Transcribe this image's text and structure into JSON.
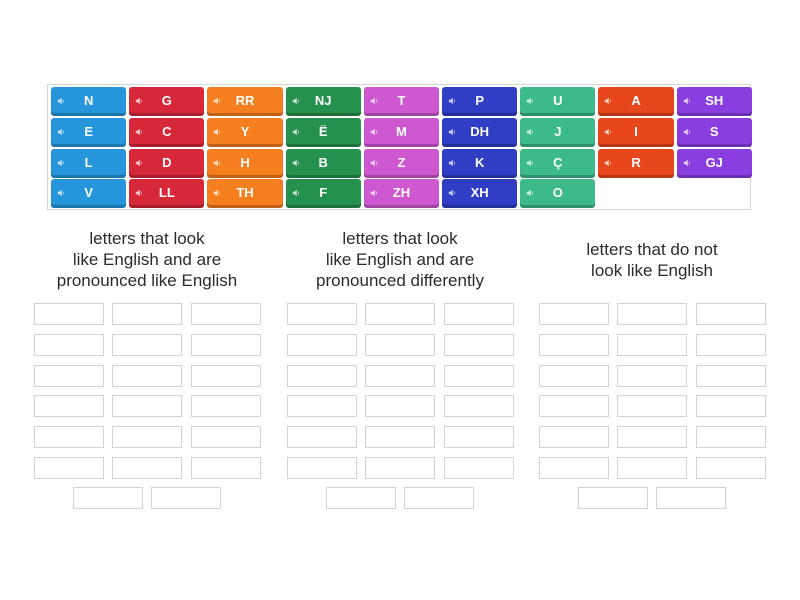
{
  "tiles": [
    {
      "label": "N",
      "color": "#2596dc"
    },
    {
      "label": "G",
      "color": "#d7283a"
    },
    {
      "label": "RR",
      "color": "#f57e1e"
    },
    {
      "label": "NJ",
      "color": "#24914f"
    },
    {
      "label": "T",
      "color": "#cd58d0"
    },
    {
      "label": "P",
      "color": "#2f3ec4"
    },
    {
      "label": "U",
      "color": "#3dba8a"
    },
    {
      "label": "A",
      "color": "#e8471b"
    },
    {
      "label": "SH",
      "color": "#8a3ee0"
    },
    {
      "label": "E",
      "color": "#2596dc"
    },
    {
      "label": "C",
      "color": "#d7283a"
    },
    {
      "label": "Y",
      "color": "#f57e1e"
    },
    {
      "label": "Ë",
      "color": "#24914f"
    },
    {
      "label": "M",
      "color": "#cd58d0"
    },
    {
      "label": "DH",
      "color": "#2f3ec4"
    },
    {
      "label": "J",
      "color": "#3dba8a"
    },
    {
      "label": "I",
      "color": "#e8471b"
    },
    {
      "label": "S",
      "color": "#8a3ee0"
    },
    {
      "label": "L",
      "color": "#2596dc"
    },
    {
      "label": "D",
      "color": "#d7283a"
    },
    {
      "label": "H",
      "color": "#f57e1e"
    },
    {
      "label": "B",
      "color": "#24914f"
    },
    {
      "label": "Z",
      "color": "#cd58d0"
    },
    {
      "label": "K",
      "color": "#2f3ec4"
    },
    {
      "label": "Ç",
      "color": "#3dba8a"
    },
    {
      "label": "R",
      "color": "#e8471b"
    },
    {
      "label": "GJ",
      "color": "#8a3ee0"
    },
    {
      "label": "V",
      "color": "#2596dc"
    },
    {
      "label": "LL",
      "color": "#d7283a"
    },
    {
      "label": "TH",
      "color": "#f57e1e"
    },
    {
      "label": "F",
      "color": "#24914f"
    },
    {
      "label": "ZH",
      "color": "#cd58d0"
    },
    {
      "label": "XH",
      "color": "#2f3ec4"
    },
    {
      "label": "O",
      "color": "#3dba8a"
    }
  ],
  "groups": [
    {
      "heading_lines": [
        "letters that look",
        "like English and are",
        "pronounced like English"
      ]
    },
    {
      "heading_lines": [
        "letters that look",
        "like English and are",
        "pronounced differently"
      ]
    },
    {
      "heading_lines": [
        "letters that do not",
        "look like English"
      ]
    }
  ]
}
